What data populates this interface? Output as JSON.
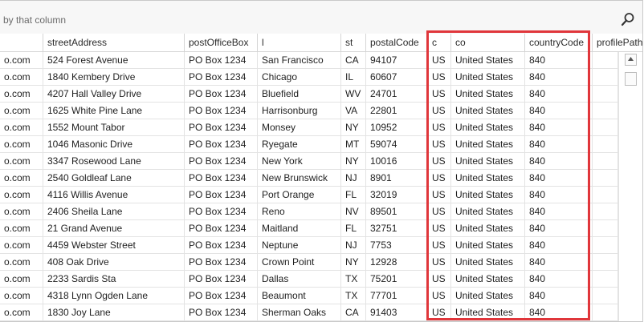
{
  "group_panel": {
    "text": "by that column"
  },
  "columns": [
    {
      "label": ""
    },
    {
      "label": "streetAddress"
    },
    {
      "label": "postOfficeBox"
    },
    {
      "label": "l"
    },
    {
      "label": "st"
    },
    {
      "label": "postalCode"
    },
    {
      "label": "c"
    },
    {
      "label": "co"
    },
    {
      "label": "countryCode"
    },
    {
      "label": "profilePath"
    }
  ],
  "rows": [
    [
      "o.com",
      "524 Forest Avenue",
      "PO Box 1234",
      "San Francisco",
      "CA",
      "94107",
      "US",
      "United States",
      "840"
    ],
    [
      "o.com",
      "1840 Kembery Drive",
      "PO Box 1234",
      "Chicago",
      "IL",
      "60607",
      "US",
      "United States",
      "840"
    ],
    [
      "o.com",
      "4207 Hall Valley Drive",
      "PO Box 1234",
      "Bluefield",
      "WV",
      "24701",
      "US",
      "United States",
      "840"
    ],
    [
      "o.com",
      "1625 White Pine Lane",
      "PO Box 1234",
      "Harrisonburg",
      "VA",
      "22801",
      "US",
      "United States",
      "840"
    ],
    [
      "o.com",
      "1552 Mount Tabor",
      "PO Box 1234",
      "Monsey",
      "NY",
      "10952",
      "US",
      "United States",
      "840"
    ],
    [
      "o.com",
      "1046 Masonic Drive",
      "PO Box 1234",
      "Ryegate",
      "MT",
      "59074",
      "US",
      "United States",
      "840"
    ],
    [
      "o.com",
      "3347 Rosewood Lane",
      "PO Box 1234",
      "New York",
      "NY",
      "10016",
      "US",
      "United States",
      "840"
    ],
    [
      "o.com",
      "2540 Goldleaf Lane",
      "PO Box 1234",
      "New Brunswick",
      "NJ",
      "8901",
      "US",
      "United States",
      "840"
    ],
    [
      "o.com",
      "4116 Willis Avenue",
      "PO Box 1234",
      "Port Orange",
      "FL",
      "32019",
      "US",
      "United States",
      "840"
    ],
    [
      "o.com",
      "2406 Sheila Lane",
      "PO Box 1234",
      "Reno",
      "NV",
      "89501",
      "US",
      "United States",
      "840"
    ],
    [
      "o.com",
      "21 Grand Avenue",
      "PO Box 1234",
      "Maitland",
      "FL",
      "32751",
      "US",
      "United States",
      "840"
    ],
    [
      "o.com",
      "4459 Webster Street",
      "PO Box 1234",
      "Neptune",
      "NJ",
      "7753",
      "US",
      "United States",
      "840"
    ],
    [
      "o.com",
      "408 Oak Drive",
      "PO Box 1234",
      "Crown Point",
      "NY",
      "12928",
      "US",
      "United States",
      "840"
    ],
    [
      "o.com",
      "2233 Sardis Sta",
      "PO Box 1234",
      "Dallas",
      "TX",
      "75201",
      "US",
      "United States",
      "840"
    ],
    [
      "o.com",
      "4318 Lynn Ogden Lane",
      "PO Box 1234",
      "Beaumont",
      "TX",
      "77701",
      "US",
      "United States",
      "840"
    ],
    [
      "o.com",
      "1830 Joy Lane",
      "PO Box 1234",
      "Sherman Oaks",
      "CA",
      "91403",
      "US",
      "United States",
      "840"
    ]
  ],
  "highlight_color": "#e0363b"
}
